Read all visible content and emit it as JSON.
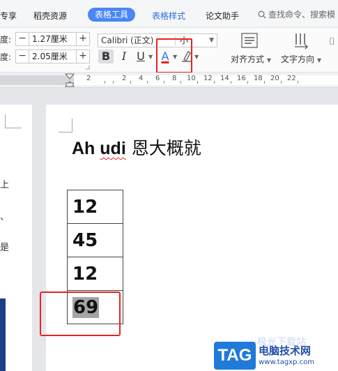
{
  "tabbar": {
    "tabs": [
      {
        "label": "专享"
      },
      {
        "label": "稻壳资源"
      },
      {
        "label": "表格工具"
      },
      {
        "label": "表格样式"
      },
      {
        "label": "论文助手"
      }
    ],
    "search_label": "查找命令、搜索模"
  },
  "ribbon": {
    "row1_label": "度:",
    "row1_value": "1.27厘米",
    "row2_label": "度:",
    "row2_value": "2.05厘米",
    "minus": "−",
    "plus": "+",
    "font_name": "Calibri (正文)",
    "font_size": "小",
    "bold": "B",
    "italic": "I",
    "underline": "U",
    "font_color": "A",
    "align_label": "对齐方式",
    "text_dir_label": "文字方向",
    "accent_color": "#4a86f5",
    "font_color_value": "#e8231e"
  },
  "ruler": {
    "ticks": [
      "2",
      "2",
      "4",
      "6",
      "8",
      "10",
      "12",
      "14",
      "16",
      "18",
      "20",
      "22"
    ]
  },
  "doc": {
    "title_latin_1": "Ah ",
    "title_latin_2": "udi",
    "title_cjk": " 恩大概就",
    "left_page_chars": [
      "上",
      "、",
      "是"
    ],
    "table": [
      "12",
      "45",
      "12",
      "69"
    ]
  },
  "watermark": {
    "tag": "TAG",
    "site": "电脑技术网",
    "url": "www.tagxp.com",
    "ghost": "极光下载站"
  }
}
